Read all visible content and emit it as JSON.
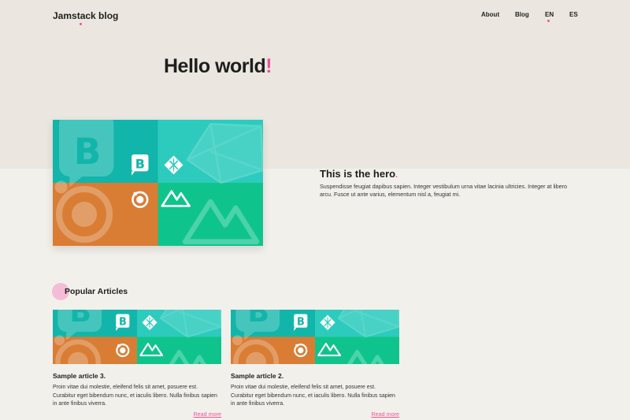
{
  "header": {
    "brand": "Jamstack blog",
    "nav": {
      "about": "About",
      "blog": "Blog",
      "lang_en": "EN",
      "lang_es": "ES"
    },
    "active_lang": "EN"
  },
  "page": {
    "title": "Hello world",
    "title_accent": "!"
  },
  "hero": {
    "heading": "This is the hero",
    "heading_accent": ".",
    "text": "Suspendisse feugiat dapibus sapien. Integer vestibulum urna vitae lacinia ultricies. Integer at libero arcu. Fusce ut ante varius, elementum nisl a, feugiat mi."
  },
  "popular": {
    "heading": "Popular Articles",
    "articles": [
      {
        "title": "Sample article 3.",
        "excerpt": "Proin vitae dui molestie, eleifend felis sit amet, posuere est. Curabitur eget bibendum nunc, et iaculis libero. Nulla finibus sapien in ante finibus viverra.",
        "link": "Read more"
      },
      {
        "title": "Sample article 2.",
        "excerpt": "Proin vitae dui molestie, eleifend felis sit amet, posuere est. Curabitur eget bibendum nunc, et iaculis libero. Nulla finibus sapien in ante finibus viverra.",
        "link": "Read more"
      }
    ]
  },
  "colors": {
    "accent": "#e8569a",
    "top_band": "#ebe7e0",
    "page_bg": "#f2f0eb",
    "tile_teal": "#12b5aa",
    "tile_light_teal": "#2ccbbd",
    "tile_orange": "#d97d35",
    "tile_green": "#0fc48c"
  },
  "icons": [
    "bootstrap-logo-icon",
    "netlify-logo-icon",
    "ionic-logo-icon",
    "nuxt-logo-icon"
  ]
}
